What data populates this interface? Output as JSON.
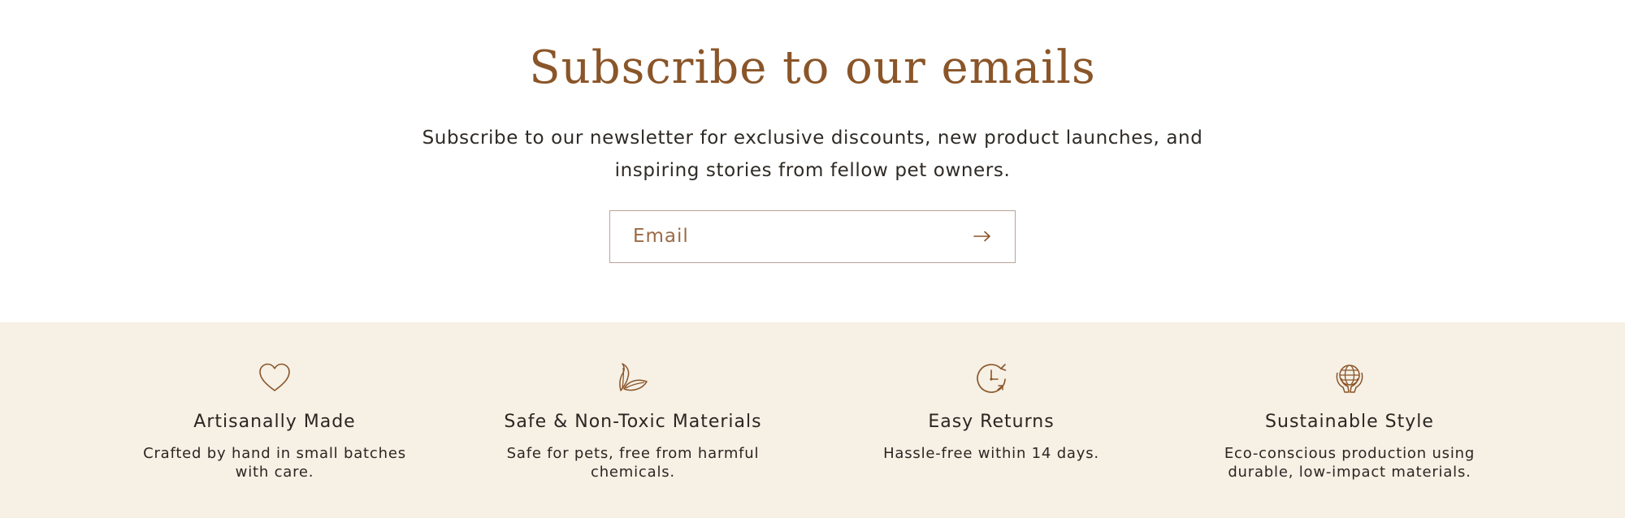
{
  "newsletter": {
    "title": "Subscribe to our emails",
    "description": "Subscribe to our newsletter for exclusive discounts, new product launches, and inspiring stories from fellow pet owners.",
    "email_placeholder": "Email",
    "submit_icon": "arrow-right-icon"
  },
  "features": [
    {
      "icon": "heart-icon",
      "title": "Artisanally Made",
      "text": "Crafted by hand in small batches with care."
    },
    {
      "icon": "leaf-icon",
      "title": "Safe & Non-Toxic Materials",
      "text": "Safe for pets, free from harmful chemicals."
    },
    {
      "icon": "clock-return-icon",
      "title": "Easy Returns",
      "text": "Hassle-free within 14 days."
    },
    {
      "icon": "globe-hands-icon",
      "title": "Sustainable Style",
      "text": "Eco-conscious production using durable, low-impact materials."
    }
  ],
  "colors": {
    "accent": "#8a5528",
    "features_background": "#f6f0e5",
    "input_border": "#b9a39a",
    "text": "#2b2622"
  }
}
